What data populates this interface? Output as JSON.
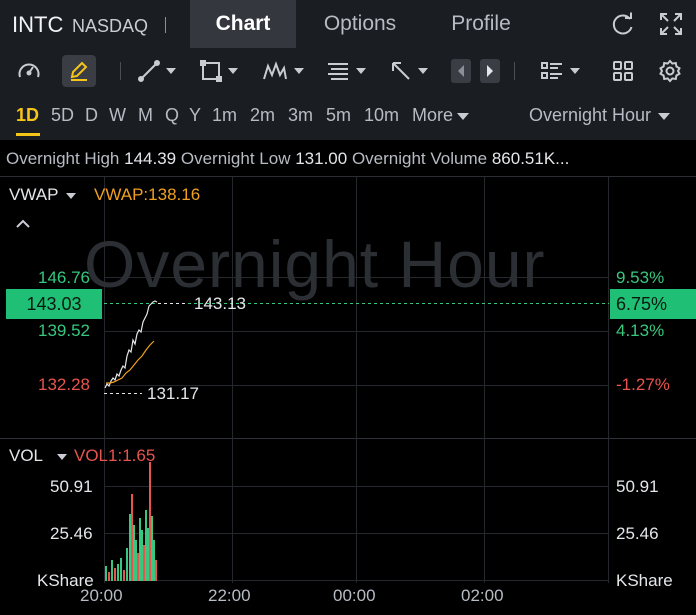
{
  "header": {
    "ticker": "INTC",
    "exchange": "NASDAQ",
    "tabs": [
      {
        "label": "Chart",
        "active": true
      },
      {
        "label": "Options",
        "active": false
      },
      {
        "label": "Profile",
        "active": false
      }
    ],
    "icons": [
      "refresh-icon",
      "fullscreen-icon"
    ]
  },
  "toolbar": {
    "icons": [
      "gauge-icon",
      "draw-pencil-icon",
      "trend-line-icon",
      "rectangle-icon",
      "pattern-icon",
      "fib-icon",
      "arrow-icon",
      "prev-arrow-icon",
      "next-arrow-icon",
      "indicator-list-icon",
      "layout-grid-icon",
      "settings-icon"
    ]
  },
  "periods": {
    "items": [
      "1D",
      "5D",
      "D",
      "W",
      "M",
      "Q",
      "Y",
      "1m",
      "2m",
      "3m",
      "5m",
      "10m"
    ],
    "active": "1D",
    "more_label": "More",
    "session_label": "Overnight Hour"
  },
  "info": {
    "high_label": "Overnight High",
    "high_value": "144.39",
    "low_label": "Overnight Low",
    "low_value": "131.00",
    "volume_label": "Overnight Volume",
    "volume_value": "860.51K..."
  },
  "main_chart": {
    "indicator": "VWAP",
    "indicator_value": "VWAP:138.16",
    "watermark": "Overnight Hour",
    "price_labels": [
      "146.76",
      "139.52",
      "132.28"
    ],
    "current_price": "143.03",
    "pct_labels": [
      "9.53%",
      "4.13%",
      "-1.27%"
    ],
    "current_pct": "6.75%",
    "high_marker": "143.13",
    "low_marker": "131.17"
  },
  "volume_chart": {
    "indicator": "VOL",
    "indicator_value": "VOL1:1.65",
    "axis_left": [
      "50.91",
      "25.46",
      "KShare"
    ],
    "axis_right": [
      "50.91",
      "25.46",
      "KShare"
    ]
  },
  "time_axis": [
    "20:00",
    "22:00",
    "00:00",
    "02:00"
  ],
  "colors": {
    "up": "#37c77f",
    "down": "#e8544e",
    "accent": "#f5c518",
    "vwap": "#f0a020",
    "background": "#000000"
  }
}
